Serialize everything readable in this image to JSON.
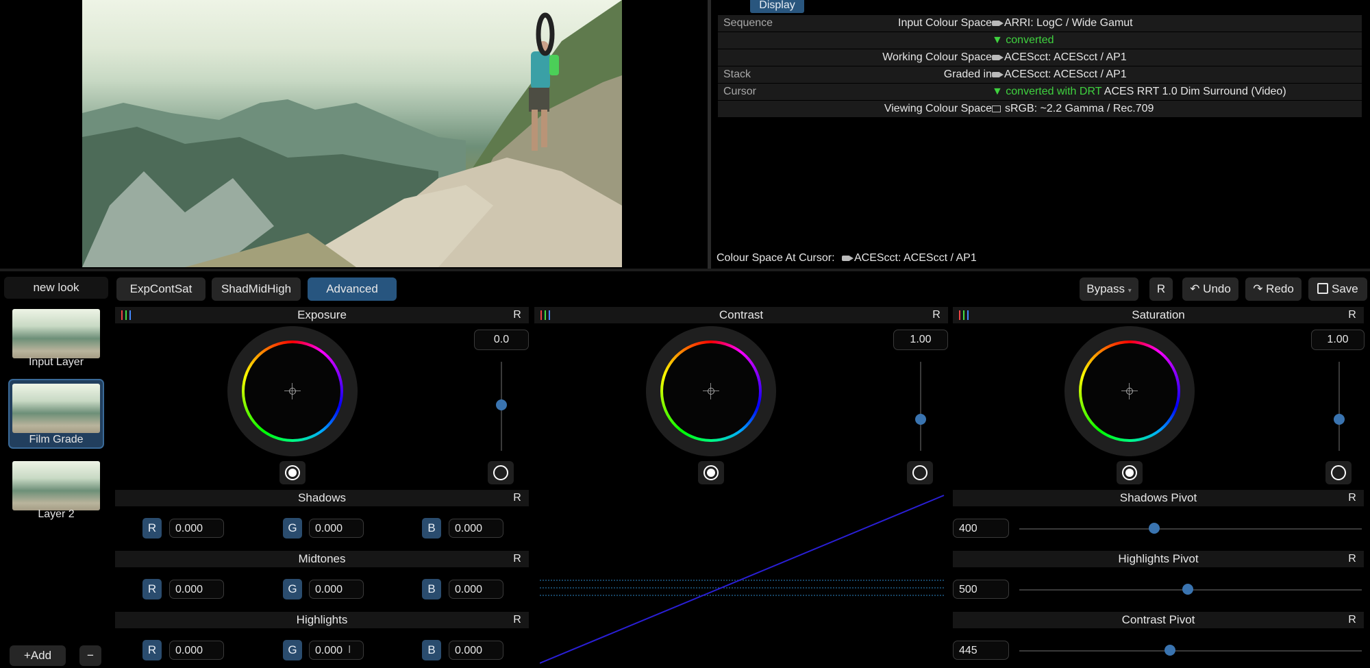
{
  "info_panel": {
    "display_tab": "Display",
    "rows": [
      {
        "section": "Sequence",
        "key": "Input Colour Space",
        "icon": "camera-icon",
        "value_prefix": "",
        "value": "ARRI: LogC / Wide Gamut"
      },
      {
        "section": "",
        "key": "",
        "icon": "",
        "value_prefix": "▼ converted",
        "value": ""
      },
      {
        "section": "",
        "key": "Working Colour Space",
        "icon": "camera-icon",
        "value_prefix": "",
        "value": "ACEScct: ACEScct / AP1"
      },
      {
        "section": "Stack",
        "key": "Graded in",
        "icon": "camera-icon",
        "value_prefix": "",
        "value": "ACEScct: ACEScct / AP1"
      },
      {
        "section": "Cursor",
        "key": "",
        "icon": "",
        "value_prefix": "▼ converted with DRT",
        "value": "ACES RRT 1.0 Dim Surround (Video)"
      },
      {
        "section": "",
        "key": "Viewing Colour Space",
        "icon": "monitor-icon",
        "value_prefix": "",
        "value": "sRGB: ~2.2 Gamma / Rec.709"
      }
    ],
    "cursor_label": "Colour Space At Cursor:",
    "cursor_value": "ACEScct: ACEScct / AP1"
  },
  "look_name": "new look",
  "layers": [
    {
      "label": "Input Layer",
      "selected": false
    },
    {
      "label": "Film Grade",
      "selected": true
    },
    {
      "label": "Layer 2",
      "selected": false
    }
  ],
  "layer_actions": {
    "add": "Add",
    "add_icon": "+",
    "remove": "−"
  },
  "tabs": [
    {
      "label": "ExpContSat",
      "active": false
    },
    {
      "label": "ShadMidHigh",
      "active": false
    },
    {
      "label": "Advanced",
      "active": true
    }
  ],
  "toolbar": {
    "bypass": "Bypass",
    "reset": "R",
    "undo": "Undo",
    "redo": "Redo",
    "save": "Save"
  },
  "wheels": [
    {
      "title": "Exposure",
      "reset": "R",
      "value": "0.0",
      "slider_fraction": 0.5
    },
    {
      "title": "Contrast",
      "reset": "R",
      "value": "1.00",
      "slider_fraction": 0.7
    },
    {
      "title": "Saturation",
      "reset": "R",
      "value": "1.00",
      "slider_fraction": 0.7
    }
  ],
  "tone_sections": [
    {
      "title": "Shadows",
      "reset": "R",
      "r": "0.000",
      "g": "0.000",
      "b": "0.000"
    },
    {
      "title": "Midtones",
      "reset": "R",
      "r": "0.000",
      "g": "0.000",
      "b": "0.000"
    },
    {
      "title": "Highlights",
      "reset": "R",
      "r": "0.000",
      "g": "0.000",
      "b": "0.000"
    }
  ],
  "channel_labels": {
    "r": "R",
    "g": "G",
    "b": "B"
  },
  "pivots": [
    {
      "title": "Shadows Pivot",
      "reset": "R",
      "value": "400",
      "fraction": 0.39
    },
    {
      "title": "Highlights Pivot",
      "reset": "R",
      "value": "500",
      "fraction": 0.49
    },
    {
      "title": "Contrast Pivot",
      "reset": "R",
      "value": "445",
      "fraction": 0.44
    }
  ],
  "colors": {
    "accent": "#27557f",
    "green": "#3fd23f",
    "curve": "#2a1fd6"
  }
}
